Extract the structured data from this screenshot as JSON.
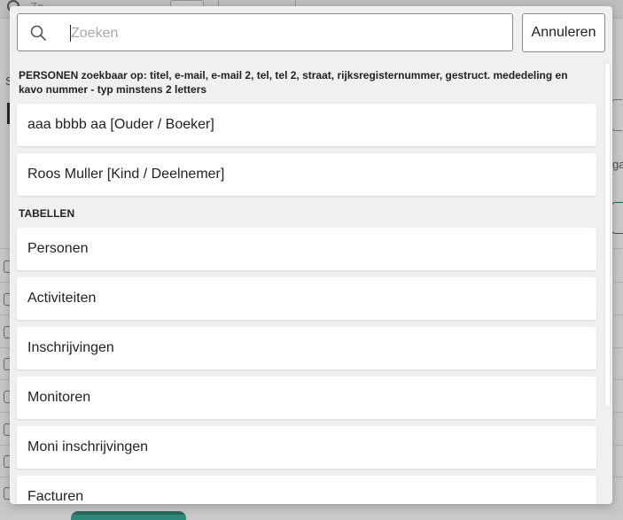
{
  "search": {
    "placeholder": "Zoeken",
    "value": ""
  },
  "cancel_label": "Annuleren",
  "persons_section": {
    "heading": "PERSONEN zoekbaar op: titel, e-mail, e-mail 2, tel, tel 2, straat, rijksregisternummer, gestruct. mededeling en kavo nummer - typ minstens 2 letters",
    "results": [
      {
        "label": "aaa bbbb aa [Ouder / Boeker]"
      },
      {
        "label": "Roos Muller [Kind / Deelnemer]"
      }
    ]
  },
  "tables_section": {
    "heading": "TABELLEN",
    "results": [
      {
        "label": "Personen"
      },
      {
        "label": "Activiteiten"
      },
      {
        "label": "Inschrijvingen"
      },
      {
        "label": "Monitoren"
      },
      {
        "label": "Moni inschrijvingen"
      },
      {
        "label": "Facturen"
      }
    ]
  },
  "background": {
    "search_hint": "Zo",
    "left_initial": "S",
    "right_partial": "ga"
  },
  "colors": {
    "modal_bg": "#f0f0f1",
    "card_bg": "#ffffff",
    "border": "#8a8a8a",
    "accent": "#2c7a7b"
  }
}
